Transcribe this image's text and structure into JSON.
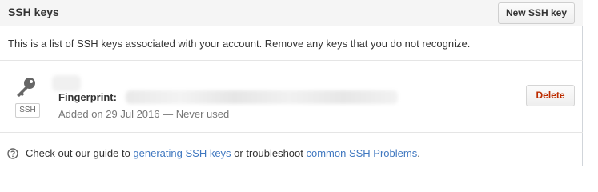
{
  "header": {
    "title": "SSH keys",
    "new_button_label": "New SSH key"
  },
  "intro": {
    "text": "This is a list of SSH keys associated with your account. Remove any keys that you do not recognize."
  },
  "keys": [
    {
      "badge": "SSH",
      "fingerprint_label": "Fingerprint:",
      "added": "Added on 29 Jul 2016 — Never used",
      "delete_label": "Delete"
    }
  ],
  "help": {
    "prefix": "Check out our guide to ",
    "link1": "generating SSH keys",
    "middle": " or troubleshoot ",
    "link2": "common SSH Problems",
    "suffix": "."
  },
  "colors": {
    "link": "#4078c0",
    "danger": "#bd2c00",
    "header_bg": "#f5f5f5"
  },
  "icons": {
    "key": "key-icon",
    "help": "question-circle-icon"
  }
}
